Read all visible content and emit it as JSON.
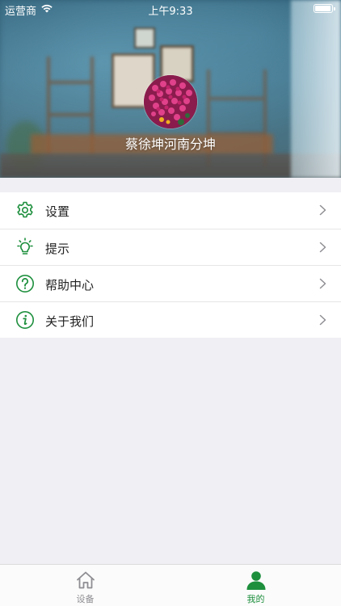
{
  "status_bar": {
    "carrier": "运营商",
    "time": "上午9:33"
  },
  "profile": {
    "name": "蔡徐坤河南分坤"
  },
  "menu": {
    "items": [
      {
        "label": "设置",
        "icon": "gear-icon"
      },
      {
        "label": "提示",
        "icon": "lightbulb-icon"
      },
      {
        "label": "帮助中心",
        "icon": "question-circle-icon"
      },
      {
        "label": "关于我们",
        "icon": "info-circle-icon"
      }
    ]
  },
  "tabbar": {
    "tabs": [
      {
        "label": "设备",
        "icon": "home-icon",
        "active": false
      },
      {
        "label": "我的",
        "icon": "person-icon",
        "active": true
      }
    ]
  },
  "colors": {
    "accent": "#1d8f3d",
    "inactive": "#8e8e93",
    "background": "#efeff4"
  }
}
